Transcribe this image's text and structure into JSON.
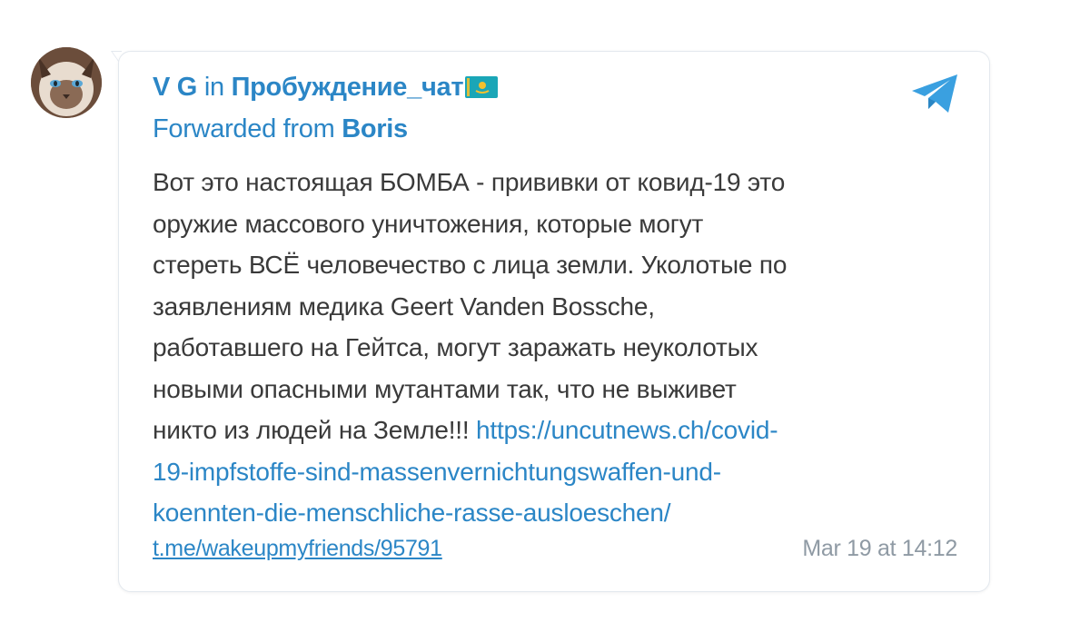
{
  "post": {
    "author": "V G",
    "in_word": "in",
    "channel": "Пробуждение_чат",
    "channel_flag_icon": "kazakhstan-flag-icon",
    "forwarded_prefix": "Forwarded from",
    "forwarded_from": "Boris",
    "message_lines": [
      "Вот это настоящая БОМБА - прививки от ковид-19 это",
      "оружие массового уничтожения, которые могут",
      "стереть ВСЁ человечество с лица земли. Уколотые по",
      "заявлениям медика Geert Vanden Bossche,",
      "работавшего на Гейтса, могут заражать неуколотых",
      "новыми опасными мутантами так, что не выживет",
      "никто из людей на Земле!!!"
    ],
    "link_lines": [
      "https://uncutnews.ch/covid-",
      "19-impfstoffe-sind-massenvernichtungswaffen-und-",
      "koennten-die-menschliche-rasse-ausloeschen/"
    ],
    "post_link": "t.me/wakeupmyfriends/95791",
    "timestamp": "Mar 19 at 14:12"
  },
  "icons": {
    "avatar": "cat-avatar",
    "share": "telegram-share-icon"
  },
  "colors": {
    "link": "#2b86c6",
    "text": "#3a3a3a",
    "muted": "#8f9aa4",
    "border": "#e3e8ee"
  }
}
